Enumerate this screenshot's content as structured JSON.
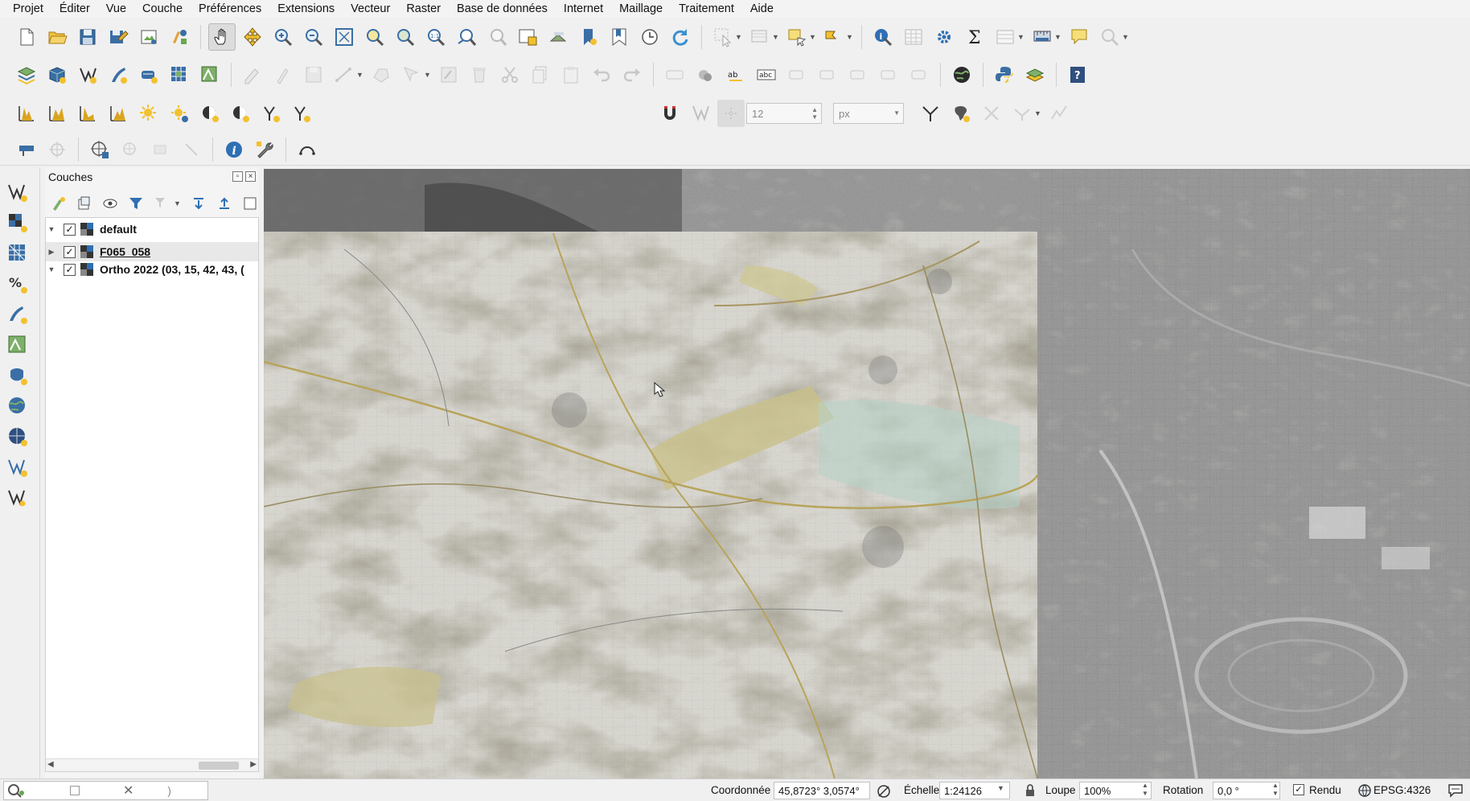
{
  "menu": [
    "Projet",
    "Éditer",
    "Vue",
    "Couche",
    "Préférences",
    "Extensions",
    "Vecteur",
    "Raster",
    "Base de données",
    "Internet",
    "Maillage",
    "Traitement",
    "Aide"
  ],
  "snapping": {
    "tolerance": "12",
    "units": "px"
  },
  "layers_panel": {
    "title": "Couches",
    "layers": [
      {
        "name": "default",
        "checked": true,
        "expanded": true
      },
      {
        "name": "F065_058",
        "checked": true,
        "expanded": false
      },
      {
        "name": "Ortho 2022 (03, 15, 42, 43, (",
        "checked": true,
        "expanded": true
      }
    ]
  },
  "statusbar": {
    "coord_label": "Coordonnée",
    "coord_value": "45,8723° 3,0574°",
    "scale_label": "Échelle",
    "scale_value": "1:24126",
    "magnifier_label": "Loupe",
    "magnifier_value": "100%",
    "rotation_label": "Rotation",
    "rotation_value": "0,0 °",
    "render_label": "Rendu",
    "crs": "EPSG:4326"
  },
  "icons": {
    "toolbar1": [
      "new-project-icon",
      "open-project-icon",
      "save-project-icon",
      "save-as-icon",
      "print-layout-icon",
      "style-manager-icon",
      "pan-hand-icon",
      "pan-to-selection-icon",
      "zoom-in-icon",
      "zoom-out-icon",
      "zoom-full-icon",
      "zoom-selection-icon",
      "zoom-layer-icon",
      "zoom-native-icon",
      "zoom-last-icon",
      "zoom-next-icon",
      "new-map-view-icon",
      "new-3d-view-icon",
      "new-bookmark-icon",
      "show-bookmarks-icon",
      "temporal-controller-icon",
      "refresh-icon",
      "select-features-icon",
      "deselect-icon",
      "select-by-expression-icon",
      "identify-icon",
      "attribute-table-icon",
      "processing-toolbox-icon",
      "statistics-icon",
      "field-calculator-icon",
      "measure-icon",
      "tips-icon",
      "zoom-to-native-icon"
    ],
    "colors": {
      "accent": "#2f6fb3",
      "yellow": "#f2c12e",
      "green": "#4a9b3a"
    }
  }
}
